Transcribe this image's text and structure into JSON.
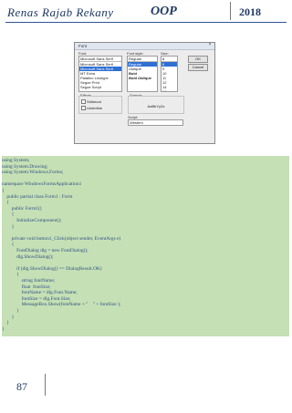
{
  "header": {
    "author": "Renas Rajab Rekany",
    "title": "OOP",
    "year": "2018"
  },
  "font_dialog": {
    "title": "Font",
    "font_label": "Font:",
    "font_value": "Microsoft Sans Serif",
    "font_list": [
      "Microsoft Sans Serif",
      "Microsoft Sans Serif",
      "MT Extra",
      "Palatino Linotype",
      "Segoe Print",
      "Segoe Script"
    ],
    "style_label": "Font style:",
    "style_value": "Regular",
    "style_list": [
      "Regular",
      "Oblique",
      "Bold",
      "Bold Oblique"
    ],
    "size_label": "Size:",
    "size_value": "8",
    "size_list": [
      "8",
      "9",
      "10",
      "11",
      "12",
      "14",
      "16"
    ],
    "ok": "OK",
    "cancel": "Cancel",
    "effects_label": "Effects",
    "strikeout": "Strikeout",
    "underline": "Underline",
    "sample_label": "Sample",
    "sample_text": "AaBbYyZz",
    "script_label": "Script:",
    "script_value": "Western"
  },
  "code_lines": [
    "using System;",
    "using System.Drawing;",
    "using System.Windows.Forms;",
    "",
    "namespace WindowsFormsApplication1",
    "{",
    "    public partial class Form1 : Form",
    "    {",
    "        public Form1()",
    "        {",
    "            InitializeComponent();",
    "        }",
    "",
    "        private void button1_Click(object sender, EventArgs e)",
    "        {",
    "            FontDialog dlg = new FontDialog();",
    "            dlg.ShowDialog();",
    "",
    "            if (dlg.ShowDialog() == DialogResult.OK)",
    "            {",
    "                string fontName;",
    "                float  fontSize;",
    "                fontName = dlg.Font.Name;",
    "                fontSize = dlg.Font.Size;",
    "                MessageBox.Show(fontName + \"    \" + fontSize );",
    "            }",
    "        }",
    "    }",
    "}"
  ],
  "footer": {
    "page_number": "87"
  }
}
